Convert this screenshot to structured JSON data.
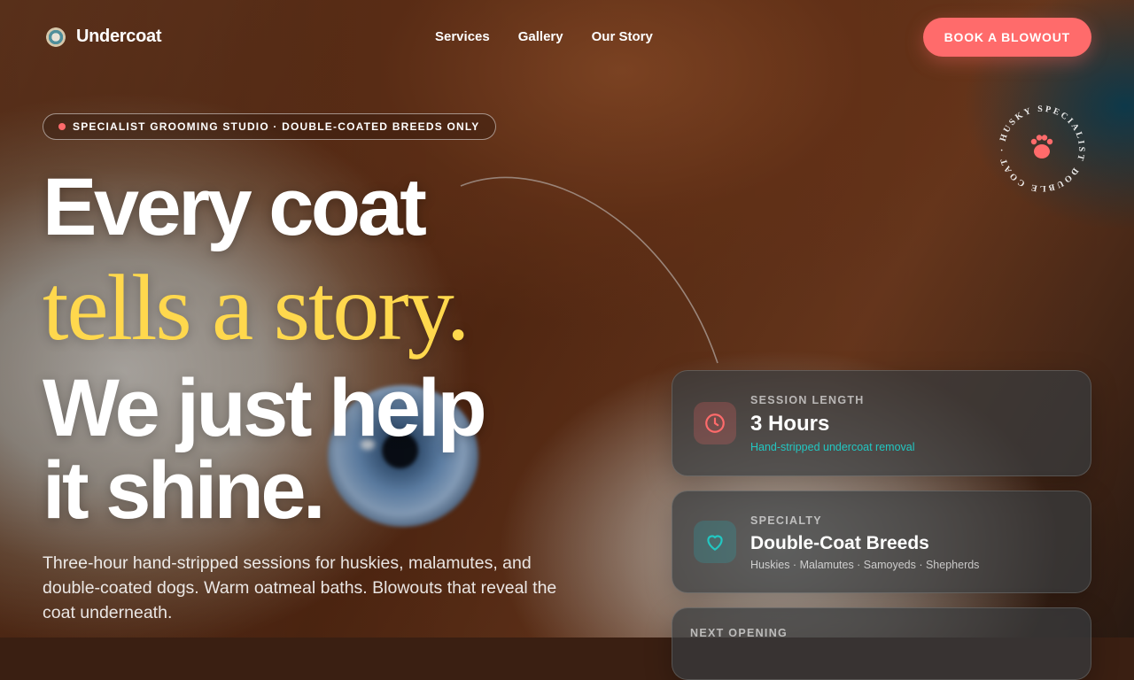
{
  "brand": {
    "name": "Undercoat",
    "logo_icon": "logo-mark-icon"
  },
  "nav": {
    "items": [
      "Services",
      "Gallery",
      "Our Story"
    ]
  },
  "cta": {
    "label": "BOOK A BLOWOUT",
    "color": "#ff6b6b"
  },
  "badge": {
    "text": "SPECIALIST GROOMING STUDIO · DOUBLE-COATED BREEDS ONLY"
  },
  "hero": {
    "line1": "Every coat",
    "line2": "tells a story.",
    "line3": "We just help",
    "line4": "it shine.",
    "accent_color": "#ffd84d",
    "lead": "Three-hour hand-stripped sessions for huskies, malamutes, and double-coated dogs. Warm oatmeal baths. Blowouts that reveal the coat underneath."
  },
  "stamp": {
    "ring_text": "DOUBLE COAT · HUSKY SPECIALIST ·",
    "icon": "paw-icon"
  },
  "cards": [
    {
      "label": "SESSION LENGTH",
      "title": "3 Hours",
      "sub": "Hand-stripped undercoat removal",
      "icon": "clock-icon"
    },
    {
      "label": "SPECIALTY",
      "title": "Double-Coat Breeds",
      "sub": "Huskies · Malamutes · Samoyeds · Shepherds",
      "icon": "heart-icon"
    },
    {
      "label": "NEXT OPENING"
    }
  ]
}
